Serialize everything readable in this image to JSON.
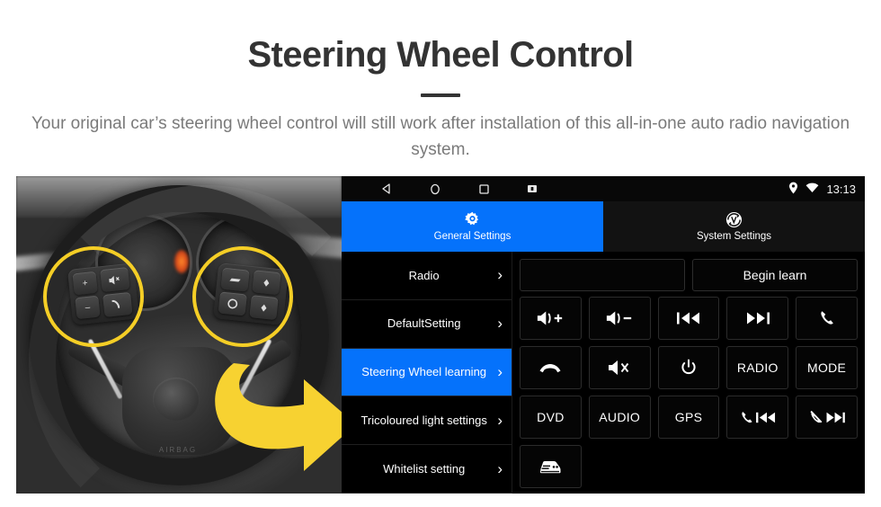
{
  "header": {
    "title": "Steering Wheel Control",
    "subtitle": "Your original car’s steering wheel control will still work after installation of this all-in-one auto radio navigation system."
  },
  "colors": {
    "accent_blue": "#0572FB",
    "highlight_yellow": "#F5CE26",
    "arrow_yellow": "#F7D231",
    "title_gray": "#333333",
    "subtitle_gray": "#7a7a7a",
    "panel_black": "#000000"
  },
  "photo": {
    "alt": "Grayscale photo of a car steering wheel with two yellow circles highlighting the left and right steering wheel control button clusters, and a yellow arrow pointing right toward the head unit screen",
    "left_cluster_buttons": [
      "volume-up",
      "volume-down",
      "voice-mute",
      "phone-call"
    ],
    "right_cluster_buttons": [
      "cruise-set",
      "up-arrow",
      "cruise-resume",
      "down-arrow"
    ],
    "airbag_text": "AIRBAG"
  },
  "statusbar": {
    "nav_icons": [
      "back-icon",
      "home-icon",
      "recents-icon",
      "screenshot-icon"
    ],
    "location_icon": "location-pin-icon",
    "wifi_icon": "wifi-icon",
    "time": "13:13"
  },
  "tabs": [
    {
      "label": "General Settings",
      "icon": "gear-icon",
      "active": true
    },
    {
      "label": "System Settings",
      "icon": "system-logo-icon",
      "active": false
    }
  ],
  "sidebar": {
    "items": [
      {
        "label": "Radio",
        "active": false,
        "chevron": "›"
      },
      {
        "label": "DefaultSetting",
        "active": false,
        "chevron": "›"
      },
      {
        "label": "Steering Wheel learning",
        "active": true,
        "chevron": "›"
      },
      {
        "label": "Tricoloured light settings",
        "active": false,
        "chevron": "›"
      },
      {
        "label": "Whitelist setting",
        "active": false,
        "chevron": "›"
      }
    ]
  },
  "content": {
    "input_value": "",
    "input_placeholder": "",
    "begin_learn_label": "Begin learn",
    "keys": [
      {
        "name": "volume-up-key",
        "type": "icon",
        "icon": "volume-plus-icon",
        "label": ""
      },
      {
        "name": "volume-down-key",
        "type": "icon",
        "icon": "volume-minus-icon",
        "label": ""
      },
      {
        "name": "previous-track-key",
        "type": "icon",
        "icon": "previous-track-icon",
        "label": ""
      },
      {
        "name": "next-track-key",
        "type": "icon",
        "icon": "next-track-icon",
        "label": ""
      },
      {
        "name": "call-answer-key",
        "type": "icon",
        "icon": "phone-handset-icon",
        "label": ""
      },
      {
        "name": "call-hangup-key",
        "type": "icon",
        "icon": "phone-hangup-icon",
        "label": ""
      },
      {
        "name": "mute-key",
        "type": "icon",
        "icon": "volume-mute-icon",
        "label": ""
      },
      {
        "name": "power-key",
        "type": "icon",
        "icon": "power-icon",
        "label": ""
      },
      {
        "name": "radio-key",
        "type": "text",
        "icon": "",
        "label": "RADIO"
      },
      {
        "name": "mode-key",
        "type": "text",
        "icon": "",
        "label": "MODE"
      },
      {
        "name": "dvd-key",
        "type": "text",
        "icon": "",
        "label": "DVD"
      },
      {
        "name": "audio-key",
        "type": "text",
        "icon": "",
        "label": "AUDIO"
      },
      {
        "name": "gps-key",
        "type": "text",
        "icon": "",
        "label": "GPS"
      },
      {
        "name": "call-previous-key",
        "type": "icon",
        "icon": "phone-previous-icon",
        "label": ""
      },
      {
        "name": "call-reject-next-key",
        "type": "icon",
        "icon": "phone-reject-next-icon",
        "label": ""
      },
      {
        "name": "car-info-key",
        "type": "icon",
        "icon": "car-icon",
        "label": ""
      }
    ]
  }
}
